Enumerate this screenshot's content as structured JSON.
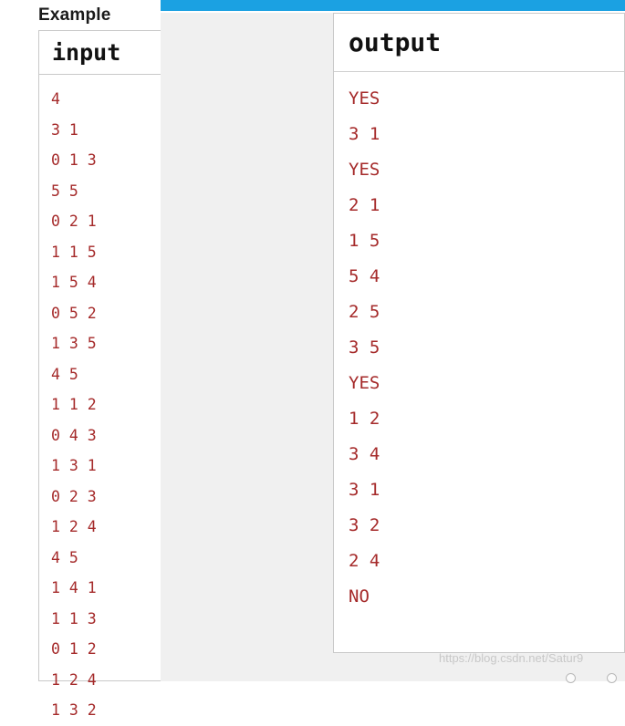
{
  "page": {
    "heading": "Example",
    "watermark": "https://blog.csdn.net/Satur9"
  },
  "input_panel": {
    "title": "input",
    "lines": [
      "4",
      "3 1",
      "0 1 3",
      "5 5",
      "0 2 1",
      "1 1 5",
      "1 5 4",
      "0 5 2",
      "1 3 5",
      "4 5",
      "1 1 2",
      "0 4 3",
      "1 3 1",
      "0 2 3",
      "1 2 4",
      "4 5",
      "1 4 1",
      "1 1 3",
      "0 1 2",
      "1 2 4",
      "1 3 2"
    ]
  },
  "output_panel": {
    "title": "output",
    "lines": [
      "YES",
      "3 1",
      "YES",
      "2 1",
      "1 5",
      "5 4",
      "2 5",
      "3 5",
      "YES",
      "1 2",
      "3 4",
      "3 1",
      "3 2",
      "2 4",
      "NO"
    ]
  },
  "colors": {
    "titlebar": "#1ba1e2",
    "code_text": "#a52a2a",
    "panel_bg": "#ffffff",
    "window_bg": "#f0f0f0"
  }
}
